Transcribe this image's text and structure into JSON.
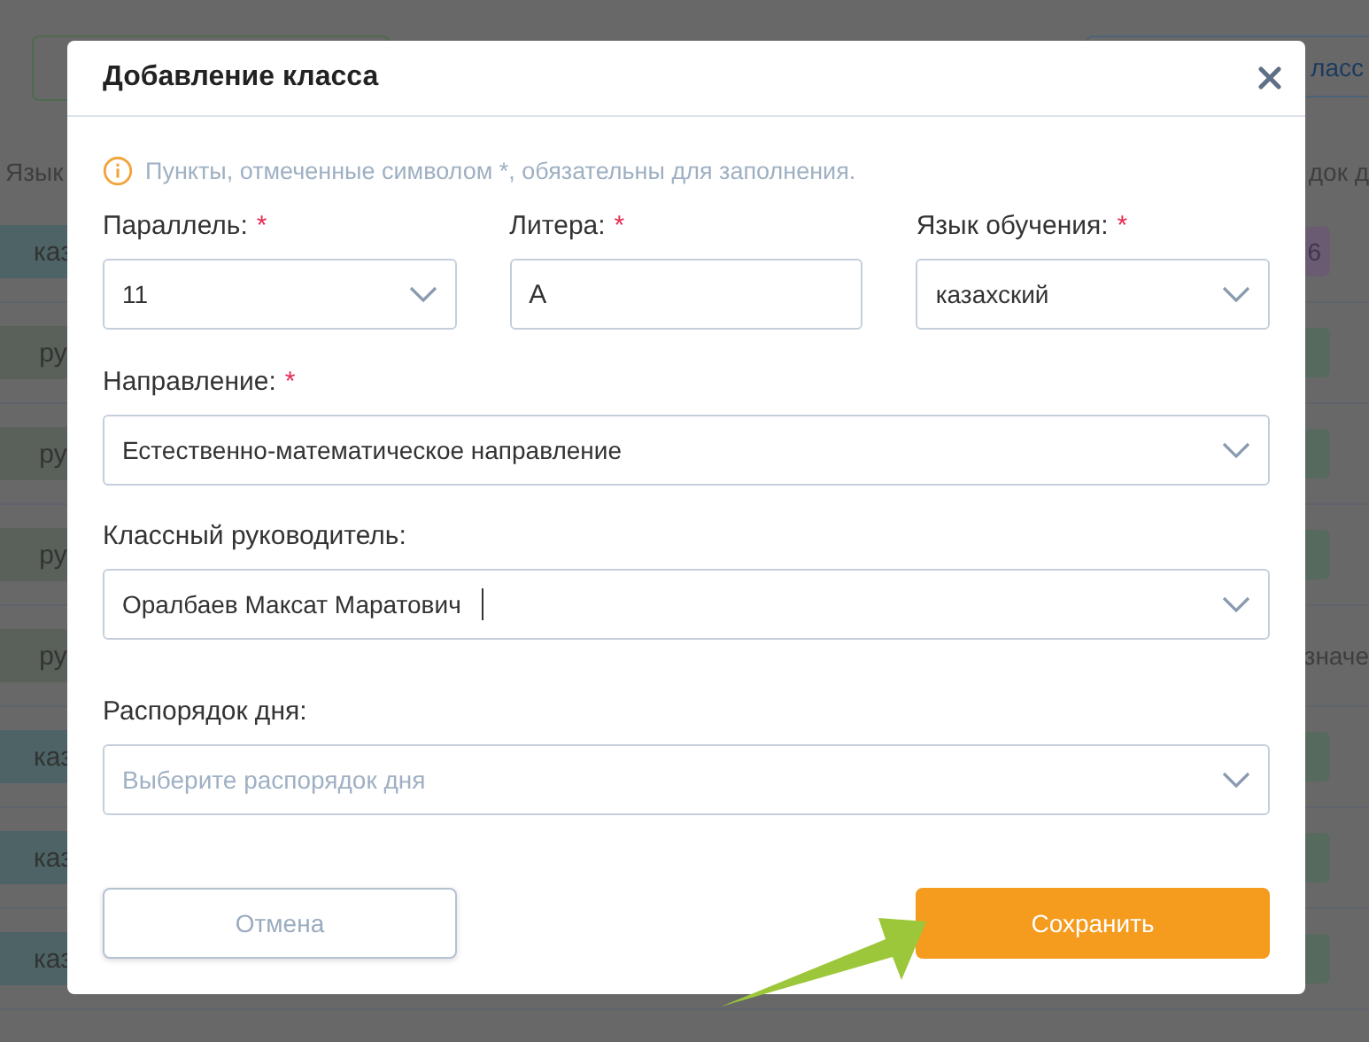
{
  "background": {
    "top_button": {
      "label": "ласс"
    },
    "header": [
      "Язык",
      "док д"
    ],
    "rows": [
      {
        "cell": "каз",
        "color": "#4d6366",
        "badge": {
          "text": "6",
          "color": "#6a5a72"
        }
      },
      {
        "cell": "ру",
        "color": "#59615a",
        "badge": {
          "color": "#566a5d"
        }
      },
      {
        "cell": "ру",
        "color": "#59615a",
        "badge": {
          "color": "#566a5d"
        }
      },
      {
        "cell": "ру",
        "color": "#59615a",
        "badge": {
          "color": "#566a5d"
        }
      },
      {
        "cell": "ру",
        "color": "#59615a",
        "note": "значе"
      },
      {
        "cell": "каз",
        "color": "#4d6366",
        "badge": {
          "color": "#566a5d"
        }
      },
      {
        "cell": "каз",
        "color": "#4d6366",
        "badge": {
          "color": "#566a5d"
        }
      },
      {
        "cell": "каз",
        "color": "#4d6366",
        "badge": {
          "color": "#566a5d"
        }
      }
    ]
  },
  "dialog": {
    "title": "Добавление класса",
    "notice": "Пункты, отмеченные символом *, обязательны для заполнения.",
    "required_mark": "*",
    "field_rows": [
      [
        {
          "label": "Параллель:",
          "kind": "select",
          "value": "11",
          "required": true,
          "focused": false
        },
        {
          "label": "Литера:",
          "kind": "input",
          "value": "А",
          "required": true,
          "focused": false
        },
        {
          "label": "Язык обучения:",
          "kind": "select",
          "value": "казахский",
          "required": true,
          "focused": false
        }
      ],
      [
        {
          "label": "Направление:",
          "kind": "select",
          "value": "Естественно-математическое направление",
          "required": true,
          "focused": false
        }
      ],
      [
        {
          "label": "Классный руководитель:",
          "kind": "select",
          "value": "Оралбаев Максат Маратович",
          "required": false,
          "focused": true
        }
      ],
      [
        {
          "label": "Распорядок дня:",
          "kind": "select",
          "placeholder": "Выберите распорядок дня",
          "required": false,
          "focused": false
        }
      ]
    ],
    "buttons": [
      {
        "label": "Отмена",
        "kind": "secondary"
      },
      {
        "label": "Сохранить",
        "kind": "primary"
      }
    ]
  }
}
